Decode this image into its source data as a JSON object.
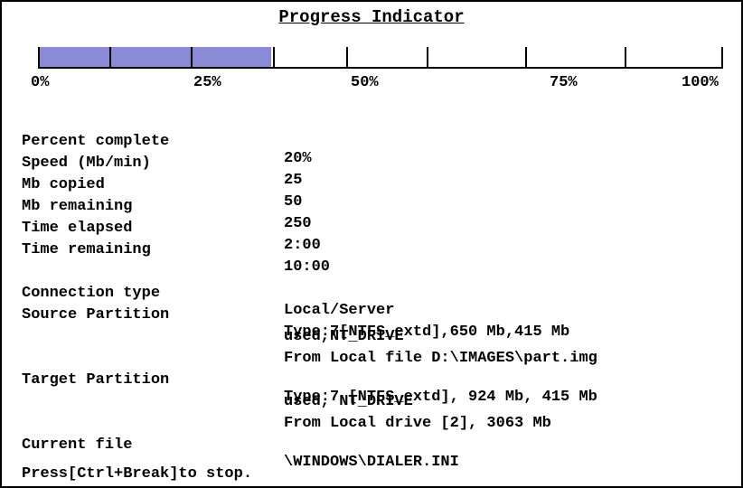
{
  "title": "Progress Indicator",
  "progress": {
    "fill_percent": 34,
    "tick_labels": [
      "0%",
      "25%",
      "50%",
      "75%",
      "100%"
    ]
  },
  "colors": {
    "bar_fill": "#8a8ad6",
    "text": "#000000",
    "background": "#ffffff"
  },
  "stats": {
    "percent_complete": {
      "label": "Percent complete",
      "value": "20%"
    },
    "speed": {
      "label": "Speed (Mb/min)",
      "value": "25"
    },
    "mb_copied": {
      "label": "Mb copied",
      "value": "50"
    },
    "mb_remaining": {
      "label": "Mb remaining",
      "value": "250"
    },
    "time_elapsed": {
      "label": "Time elapsed",
      "value": "2:00"
    },
    "time_remaining": {
      "label": "Time remaining",
      "value": "10:00"
    }
  },
  "details": {
    "connection_type": {
      "label": "Connection type",
      "value": "Local/Server"
    },
    "source_partition": {
      "label": "Source Partition",
      "line1": "Type:7[NTFS_extd],650 Mb,415 Mb",
      "line2": "used,NT_DRIVE",
      "line3": "From Local file D:\\IMAGES\\part.img"
    },
    "target_partition": {
      "label": "Target Partition",
      "line1": "Type:7 [NTFS_extd], 924 Mb, 415 Mb",
      "line2": "used, NT_DRIVE",
      "line3": "From Local drive [2], 3063 Mb"
    },
    "current_file": {
      "label": "Current file",
      "value": "\\WINDOWS\\DIALER.INI"
    }
  },
  "footer": {
    "stop_hint": "Press[Ctrl+Break]to stop."
  }
}
